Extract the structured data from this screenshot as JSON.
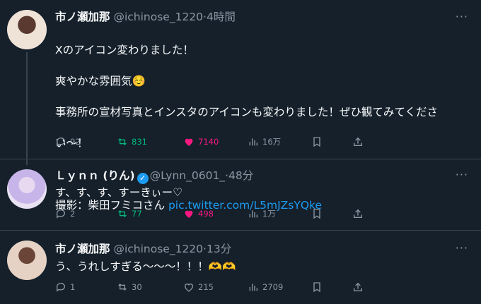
{
  "tweets": [
    {
      "name": "市ノ瀬加那",
      "handle": "@ichinose_1220",
      "time": "4時間",
      "lines": [
        "Xのアイコン変わりました！",
        "爽やかな雰囲気☺️",
        "事務所の宣材写真とインスタのアイコンも変わりました！ぜひ観てみてくださ",
        "い〜！"
      ],
      "credit": "撮影：柴田フミコさん ",
      "link": "pic.twitter.com/L5mJZsYQke",
      "replies": "92",
      "retweets": "831",
      "likes": "7140",
      "views": "16万"
    },
    {
      "name": "Ｌｙｎｎ (りん)",
      "handle": "@Lynn_0601_",
      "time": "48分",
      "text": "す、す、す、すーきぃー♡",
      "replies": "2",
      "retweets": "77",
      "likes": "498",
      "views": "1万"
    },
    {
      "name": "市ノ瀬加那",
      "handle": "@ichinose_1220",
      "time": "13分",
      "text": "う、うれしすぎる〜〜〜！！！🫶🫶",
      "replies": "1",
      "retweets": "30",
      "likes": "215",
      "views": "2709"
    }
  ],
  "more_label": "···",
  "colors": {
    "background": "#15202b",
    "accent": "#1d9bf0",
    "retweet": "#00ba7c",
    "like": "#f91880",
    "muted": "#8b98a5"
  }
}
